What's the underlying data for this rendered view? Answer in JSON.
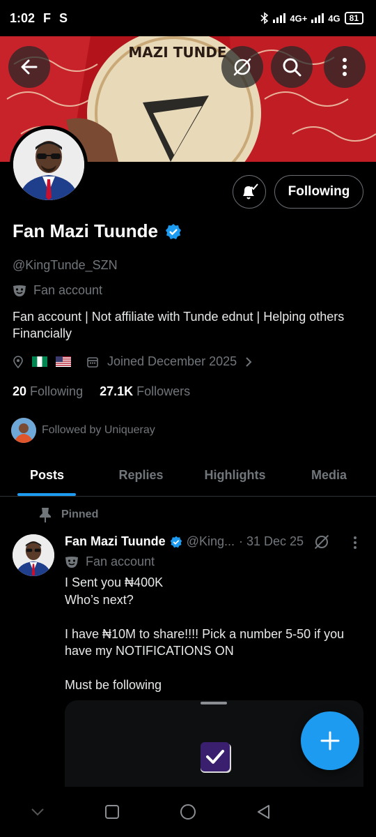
{
  "status_bar": {
    "time": "1:02",
    "net1": "4G+",
    "net2": "4G",
    "battery": "81",
    "app_icons": [
      "F",
      "S"
    ]
  },
  "banner": {
    "stamp_text": "MAZI TUNDE"
  },
  "header_buttons": {
    "back": "back-icon",
    "grok": "grok-icon",
    "search": "search-icon",
    "more": "more-icon"
  },
  "profile": {
    "name": "Fan Mazi Tuunde",
    "handle": "@KingTunde_SZN",
    "account_type": "Fan account",
    "bio": "Fan account | Not affiliate with Tunde ednut | Helping others Financially",
    "joined": "Joined December 2025",
    "following_count": "20",
    "following_label": "Following",
    "followers_count": "27.1K",
    "followers_label": "Followers",
    "followed_by": "Followed by Uniqueray",
    "follow_button": "Following",
    "verified_color": "#1d9bf0"
  },
  "tabs": [
    {
      "label": "Posts",
      "active": true
    },
    {
      "label": "Replies",
      "active": false
    },
    {
      "label": "Highlights",
      "active": false
    },
    {
      "label": "Media",
      "active": false
    }
  ],
  "post": {
    "pinned_label": "Pinned",
    "author": "Fan Mazi Tuunde",
    "handle": "@King...",
    "date": "· 31 Dec 25",
    "account_type": "Fan account",
    "text": "I Sent you ₦400K\nWho’s next?\n\nI have ₦10M to share!!!! Pick a number 5-50 if you have my NOTIFICATIONS ON\n\nMust be following"
  },
  "colors": {
    "accent": "#1d9bf0",
    "muted": "#71767b",
    "background": "#000000"
  }
}
